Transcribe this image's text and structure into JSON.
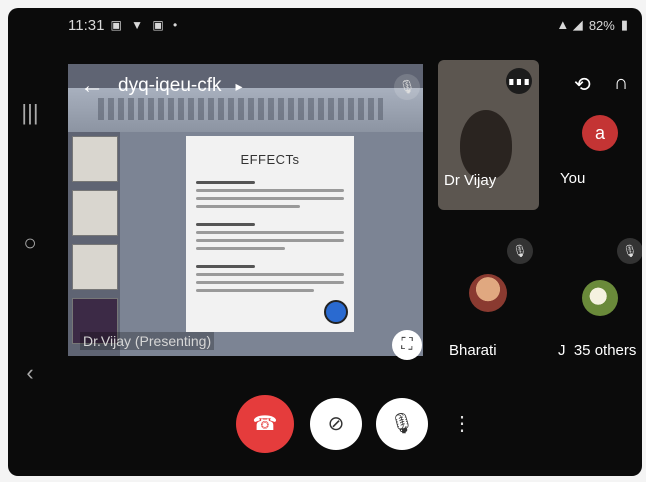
{
  "status_bar": {
    "time": "11:31",
    "battery": "82%"
  },
  "meeting": {
    "code": "dyq-iqeu-cfk",
    "code_chevron": "▸"
  },
  "shared_screen": {
    "presenter_label": "Dr.Vijay (Presenting)",
    "slide_title": "EFFECTs"
  },
  "participants": {
    "vijay": {
      "name": "Dr Vijay"
    },
    "you": {
      "name": "You",
      "avatar_letter": "a"
    },
    "bharati": {
      "name": "Bharati"
    },
    "others": {
      "name": "J",
      "count_label": "35 others"
    }
  },
  "icons": {
    "back": "←",
    "flip": "⟲",
    "audio": "🎧",
    "mic_off": "🎙̸",
    "fullscreen": "⛶",
    "end_call": "☎",
    "camera_off": "⊘",
    "more": "⋮",
    "speaking": "∎∎∎"
  },
  "colors": {
    "end_call": "#e53c3c",
    "you_avatar": "#c43434",
    "background": "#0b0b0b"
  }
}
